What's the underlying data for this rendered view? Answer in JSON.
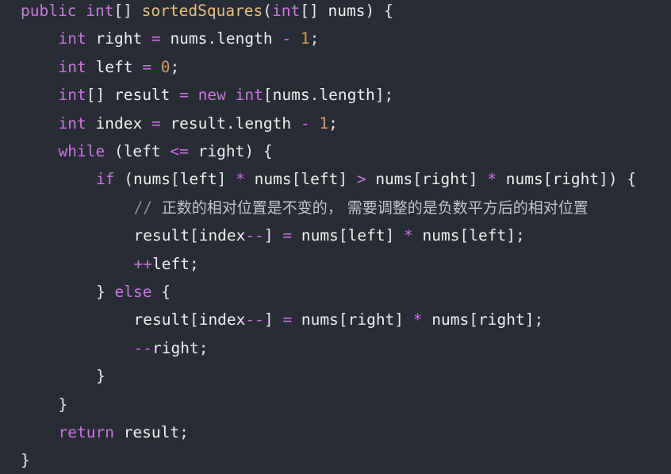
{
  "colors": {
    "background": "#282c34",
    "keyword": "#c678dd",
    "function_name": "#e5c07b",
    "number": "#d19a66",
    "operator": "#c678dd",
    "identifier": "#eeeeee",
    "comment": "#8a93a2"
  },
  "code": {
    "language": "java",
    "lines": [
      {
        "indent": 0,
        "tokens": [
          [
            "kw",
            "public"
          ],
          [
            "pun",
            " "
          ],
          [
            "kw",
            "int"
          ],
          [
            "pun",
            "[] "
          ],
          [
            "fn",
            "sortedSquares"
          ],
          [
            "pun",
            "("
          ],
          [
            "kw",
            "int"
          ],
          [
            "pun",
            "[] "
          ],
          [
            "id",
            "nums"
          ],
          [
            "pun",
            ") {"
          ]
        ]
      },
      {
        "indent": 1,
        "tokens": [
          [
            "kw",
            "int"
          ],
          [
            "pun",
            " "
          ],
          [
            "id",
            "right"
          ],
          [
            "pun",
            " "
          ],
          [
            "op",
            "="
          ],
          [
            "pun",
            " "
          ],
          [
            "id",
            "nums"
          ],
          [
            "pun",
            "."
          ],
          [
            "id",
            "length"
          ],
          [
            "pun",
            " "
          ],
          [
            "op",
            "-"
          ],
          [
            "pun",
            " "
          ],
          [
            "num",
            "1"
          ],
          [
            "pun",
            ";"
          ]
        ]
      },
      {
        "indent": 1,
        "tokens": [
          [
            "kw",
            "int"
          ],
          [
            "pun",
            " "
          ],
          [
            "id",
            "left"
          ],
          [
            "pun",
            " "
          ],
          [
            "op",
            "="
          ],
          [
            "pun",
            " "
          ],
          [
            "num",
            "0"
          ],
          [
            "pun",
            ";"
          ]
        ]
      },
      {
        "indent": 1,
        "tokens": [
          [
            "kw",
            "int"
          ],
          [
            "pun",
            "[] "
          ],
          [
            "id",
            "result"
          ],
          [
            "pun",
            " "
          ],
          [
            "op",
            "="
          ],
          [
            "pun",
            " "
          ],
          [
            "kw",
            "new"
          ],
          [
            "pun",
            " "
          ],
          [
            "kw",
            "int"
          ],
          [
            "pun",
            "["
          ],
          [
            "id",
            "nums"
          ],
          [
            "pun",
            "."
          ],
          [
            "id",
            "length"
          ],
          [
            "pun",
            "];"
          ]
        ]
      },
      {
        "indent": 1,
        "tokens": [
          [
            "kw",
            "int"
          ],
          [
            "pun",
            " "
          ],
          [
            "id",
            "index"
          ],
          [
            "pun",
            " "
          ],
          [
            "op",
            "="
          ],
          [
            "pun",
            " "
          ],
          [
            "id",
            "result"
          ],
          [
            "pun",
            "."
          ],
          [
            "id",
            "length"
          ],
          [
            "pun",
            " "
          ],
          [
            "op",
            "-"
          ],
          [
            "pun",
            " "
          ],
          [
            "num",
            "1"
          ],
          [
            "pun",
            ";"
          ]
        ]
      },
      {
        "indent": 1,
        "tokens": [
          [
            "kw",
            "while"
          ],
          [
            "pun",
            " ("
          ],
          [
            "id",
            "left"
          ],
          [
            "pun",
            " "
          ],
          [
            "op",
            "<="
          ],
          [
            "pun",
            " "
          ],
          [
            "id",
            "right"
          ],
          [
            "pun",
            ") {"
          ]
        ]
      },
      {
        "indent": 2,
        "tokens": [
          [
            "kw",
            "if"
          ],
          [
            "pun",
            " ("
          ],
          [
            "id",
            "nums"
          ],
          [
            "pun",
            "["
          ],
          [
            "id",
            "left"
          ],
          [
            "pun",
            "] "
          ],
          [
            "op",
            "*"
          ],
          [
            "pun",
            " "
          ],
          [
            "id",
            "nums"
          ],
          [
            "pun",
            "["
          ],
          [
            "id",
            "left"
          ],
          [
            "pun",
            "] "
          ],
          [
            "op",
            ">"
          ],
          [
            "pun",
            " "
          ],
          [
            "id",
            "nums"
          ],
          [
            "pun",
            "["
          ],
          [
            "id",
            "right"
          ],
          [
            "pun",
            "] "
          ],
          [
            "op",
            "*"
          ],
          [
            "pun",
            " "
          ],
          [
            "id",
            "nums"
          ],
          [
            "pun",
            "["
          ],
          [
            "id",
            "right"
          ],
          [
            "pun",
            "]) {"
          ]
        ]
      },
      {
        "indent": 3,
        "tokens": [
          [
            "cm",
            "// "
          ],
          [
            "cjk",
            "正数的相对位置是不变的， 需要调整的是负数平方后的相对位置"
          ]
        ]
      },
      {
        "indent": 3,
        "tokens": [
          [
            "id",
            "result"
          ],
          [
            "pun",
            "["
          ],
          [
            "id",
            "index"
          ],
          [
            "op",
            "--"
          ],
          [
            "pun",
            "] "
          ],
          [
            "op",
            "="
          ],
          [
            "pun",
            " "
          ],
          [
            "id",
            "nums"
          ],
          [
            "pun",
            "["
          ],
          [
            "id",
            "left"
          ],
          [
            "pun",
            "] "
          ],
          [
            "op",
            "*"
          ],
          [
            "pun",
            " "
          ],
          [
            "id",
            "nums"
          ],
          [
            "pun",
            "["
          ],
          [
            "id",
            "left"
          ],
          [
            "pun",
            "];"
          ]
        ]
      },
      {
        "indent": 3,
        "tokens": [
          [
            "op",
            "++"
          ],
          [
            "id",
            "left"
          ],
          [
            "pun",
            ";"
          ]
        ]
      },
      {
        "indent": 2,
        "tokens": [
          [
            "pun",
            "} "
          ],
          [
            "kw",
            "else"
          ],
          [
            "pun",
            " {"
          ]
        ]
      },
      {
        "indent": 3,
        "tokens": [
          [
            "id",
            "result"
          ],
          [
            "pun",
            "["
          ],
          [
            "id",
            "index"
          ],
          [
            "op",
            "--"
          ],
          [
            "pun",
            "] "
          ],
          [
            "op",
            "="
          ],
          [
            "pun",
            " "
          ],
          [
            "id",
            "nums"
          ],
          [
            "pun",
            "["
          ],
          [
            "id",
            "right"
          ],
          [
            "pun",
            "] "
          ],
          [
            "op",
            "*"
          ],
          [
            "pun",
            " "
          ],
          [
            "id",
            "nums"
          ],
          [
            "pun",
            "["
          ],
          [
            "id",
            "right"
          ],
          [
            "pun",
            "];"
          ]
        ]
      },
      {
        "indent": 3,
        "tokens": [
          [
            "op",
            "--"
          ],
          [
            "id",
            "right"
          ],
          [
            "pun",
            ";"
          ]
        ]
      },
      {
        "indent": 2,
        "tokens": [
          [
            "pun",
            "}"
          ]
        ]
      },
      {
        "indent": 1,
        "tokens": [
          [
            "pun",
            "}"
          ]
        ]
      },
      {
        "indent": 1,
        "tokens": [
          [
            "kw",
            "return"
          ],
          [
            "pun",
            " "
          ],
          [
            "id",
            "result"
          ],
          [
            "pun",
            ";"
          ]
        ]
      },
      {
        "indent": 0,
        "tokens": [
          [
            "pun",
            "}"
          ]
        ]
      }
    ]
  }
}
